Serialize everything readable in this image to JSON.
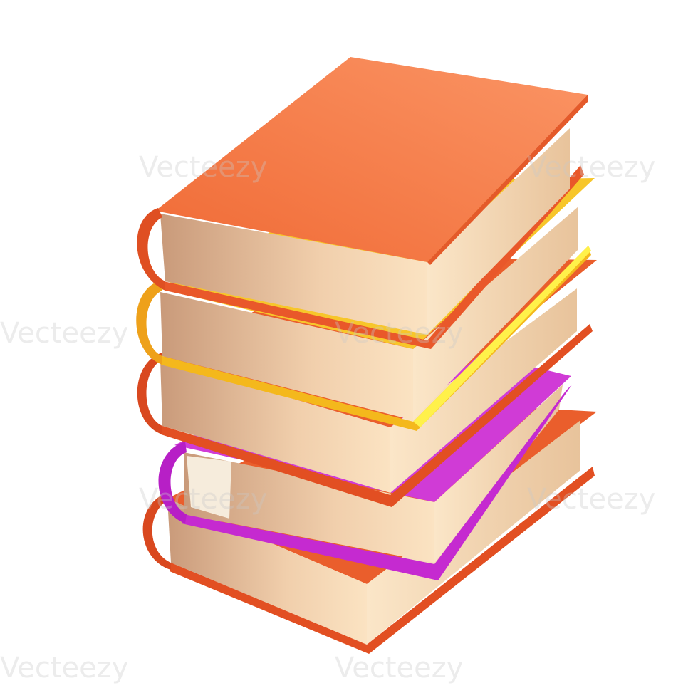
{
  "image": {
    "subject": "stack-of-books",
    "books": [
      {
        "position": "top",
        "cover_color": "#f47a45"
      },
      {
        "position": "second",
        "cover_color": "#f5b21e"
      },
      {
        "position": "third",
        "cover_color": "#e9582a"
      },
      {
        "position": "fourth",
        "cover_color": "#d23bd8"
      },
      {
        "position": "bottom",
        "cover_color": "#e9582a"
      }
    ],
    "page_color": "#f3d2a8"
  },
  "watermark": {
    "text": "Vecteezy"
  }
}
